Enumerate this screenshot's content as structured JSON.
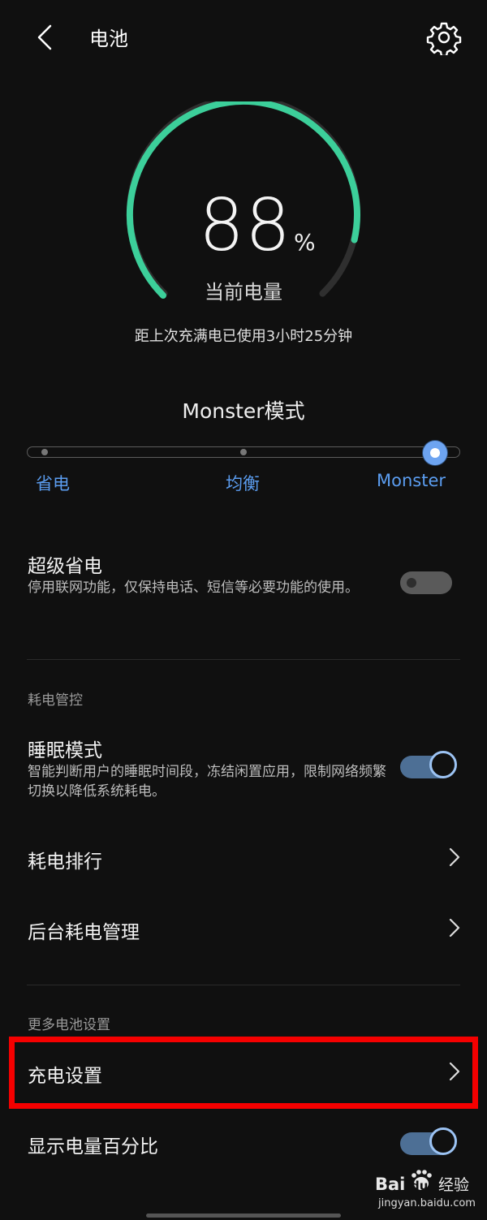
{
  "header": {
    "title": "电池"
  },
  "battery": {
    "percent": "88",
    "percent_sign": "%",
    "label": "当前电量",
    "level": 0.88,
    "usage_text": "距上次充满电已使用3小时25分钟"
  },
  "mode": {
    "title": "Monster模式",
    "options": [
      "省电",
      "均衡",
      "Monster"
    ],
    "selected": "Monster"
  },
  "super_saver": {
    "title": "超级省电",
    "desc": "停用联网功能，仅保持电话、短信等必要功能的使用。",
    "enabled": false
  },
  "power_control": {
    "section_label": "耗电管控",
    "sleep_mode": {
      "title": "睡眠模式",
      "desc": "智能判断用户的睡眠时间段，冻结闲置应用，限制网络频繁切换以降低系统耗电。",
      "enabled": true
    },
    "ranking": "耗电排行",
    "background": "后台耗电管理"
  },
  "more": {
    "section_label": "更多电池设置",
    "charging": "充电设置",
    "show_percent": {
      "title": "显示电量百分比",
      "enabled": true
    }
  },
  "watermark": {
    "text": "jingyan.baidu.com",
    "brand": "Bai du 经验"
  },
  "colors": {
    "accent": "#5b9df0",
    "gauge": "#3ccf9a",
    "highlight": "#f50000"
  }
}
